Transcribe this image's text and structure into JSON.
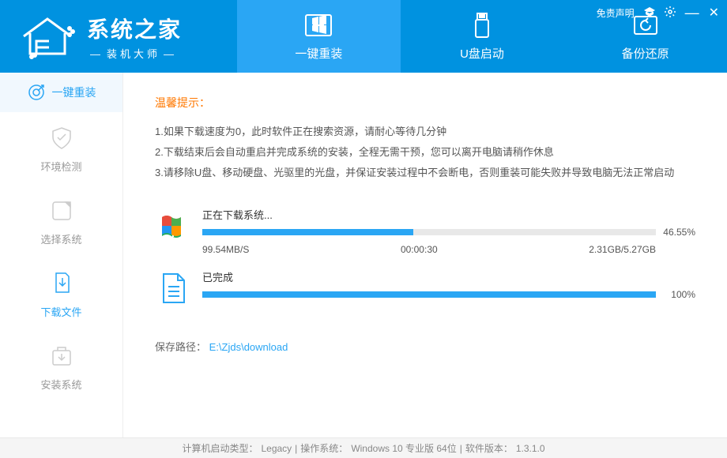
{
  "app": {
    "title": "系统之家",
    "subtitle": "装机大师",
    "disclaimer": "免责声明"
  },
  "nav": {
    "reinstall": "一键重装",
    "usb": "U盘启动",
    "backup": "备份还原"
  },
  "sidebar": {
    "top": "一键重装",
    "env": "环境检测",
    "select": "选择系统",
    "download": "下载文件",
    "install": "安装系统"
  },
  "tips": {
    "title": "温馨提示：",
    "line1": "1.如果下载速度为0，此时软件正在搜索资源，请耐心等待几分钟",
    "line2": "2.下载结束后会自动重启并完成系统的安装，全程无需干预，您可以离开电脑请稍作休息",
    "line3": "3.请移除U盘、移动硬盘、光驱里的光盘，并保证安装过程中不会断电，否则重装可能失败并导致电脑无法正常启动"
  },
  "download": {
    "status": "正在下载系统...",
    "percent": "46.55%",
    "percent_val": 46.55,
    "speed": "99.54MB/S",
    "elapsed": "00:00:30",
    "size": "2.31GB/5.27GB"
  },
  "complete": {
    "label": "已完成",
    "percent": "100%",
    "percent_val": 100
  },
  "save": {
    "label": "保存路径：",
    "path": "E:\\Zjds\\download"
  },
  "footer": {
    "boot_label": "计算机启动类型：",
    "boot_val": "Legacy",
    "os_label": "操作系统：",
    "os_val": "Windows 10 专业版 64位",
    "ver_label": "软件版本：",
    "ver_val": "1.3.1.0",
    "sep": " | "
  }
}
